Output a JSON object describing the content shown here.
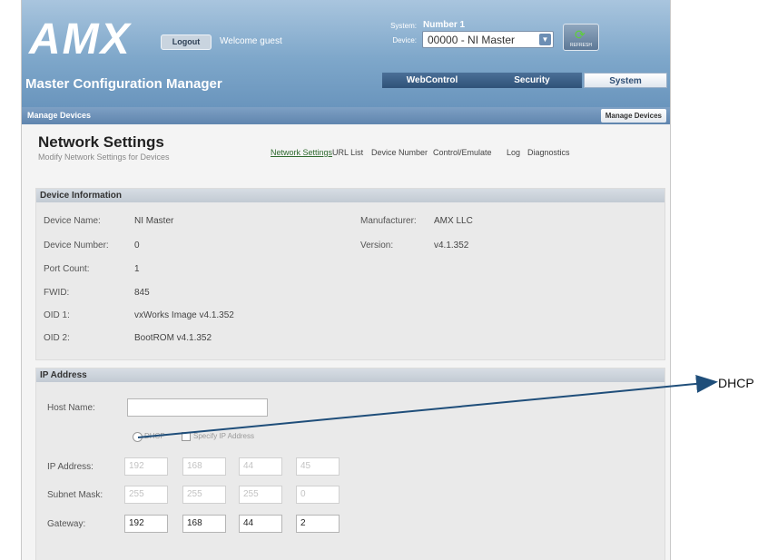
{
  "header": {
    "logo": "AMX",
    "logout_label": "Logout",
    "welcome_text": "Welcome guest",
    "system_label": "System:",
    "system_value": "Number 1",
    "device_label": "Device:",
    "device_selected": "00000 - NI Master",
    "refresh_label": "REFRESH",
    "app_title": "Master Configuration Manager",
    "tabs": [
      {
        "label": "WebControl"
      },
      {
        "label": "Security"
      },
      {
        "label": "System"
      }
    ]
  },
  "subbar": {
    "left": "Manage Devices",
    "right": "Manage Devices"
  },
  "page": {
    "title": "Network Settings",
    "subtitle": "Modify Network Settings for Devices",
    "nav": [
      {
        "label": "Network Settings"
      },
      {
        "label": "URL List"
      },
      {
        "label": "Device Number"
      },
      {
        "label": "Control/Emulate"
      },
      {
        "label": "Log"
      },
      {
        "label": "Diagnostics"
      }
    ]
  },
  "device_info": {
    "header": "Device Information",
    "rows": [
      {
        "label": "Device Name:",
        "value": "NI Master"
      },
      {
        "label": "Device Number:",
        "value": "0"
      },
      {
        "label": "Port Count:",
        "value": "1"
      },
      {
        "label": "FWID:",
        "value": "845"
      },
      {
        "label": "OID 1:",
        "value": "vxWorks Image v4.1.352"
      },
      {
        "label": "OID 2:",
        "value": "BootROM v4.1.352"
      }
    ],
    "manufacturer_label": "Manufacturer:",
    "manufacturer_value": "AMX LLC",
    "version_label": "Version:",
    "version_value": "v4.1.352"
  },
  "ip_address": {
    "header": "IP Address",
    "host_name_label": "Host Name:",
    "host_name_value": "",
    "dhcp_label": "DHCP",
    "specify_label": "Specify IP Address",
    "ip_label": "IP Address:",
    "ip": [
      "192",
      "168",
      "44",
      "45"
    ],
    "subnet_label": "Subnet Mask:",
    "subnet": [
      "255",
      "255",
      "255",
      "0"
    ],
    "gateway_label": "Gateway:",
    "gateway": [
      "192",
      "168",
      "44",
      "2"
    ]
  },
  "callout": {
    "label": "DHCP"
  },
  "colors": {
    "header_blue": "#7ea7ca",
    "tab_dark": "#2f5278",
    "callout_line": "#1f4e7a"
  }
}
